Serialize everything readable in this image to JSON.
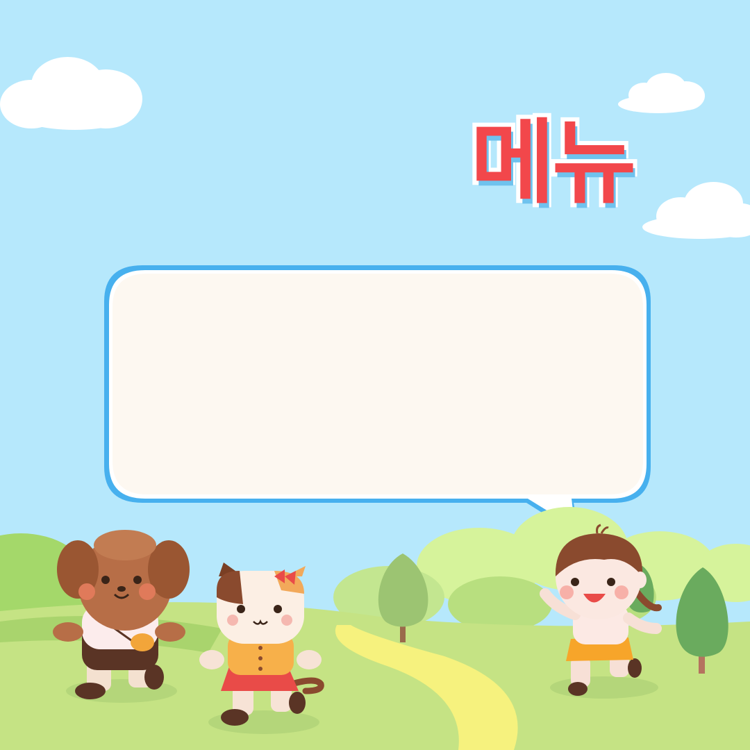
{
  "title": "메뉴",
  "speech_bubble": {
    "text": ""
  },
  "colors": {
    "sky": "#b6e8fc",
    "title_fill": "#f2474b",
    "title_outline": "#ffffff",
    "title_shadow": "#6fc2ee",
    "bubble_fill": "#fdf8f1",
    "bubble_border": "#47b0ee",
    "grass": "#c5e384",
    "path": "#f6f27e"
  },
  "illustrations": [
    "clouds",
    "hills",
    "trees",
    "dog-character",
    "cat-character",
    "girl-character"
  ]
}
